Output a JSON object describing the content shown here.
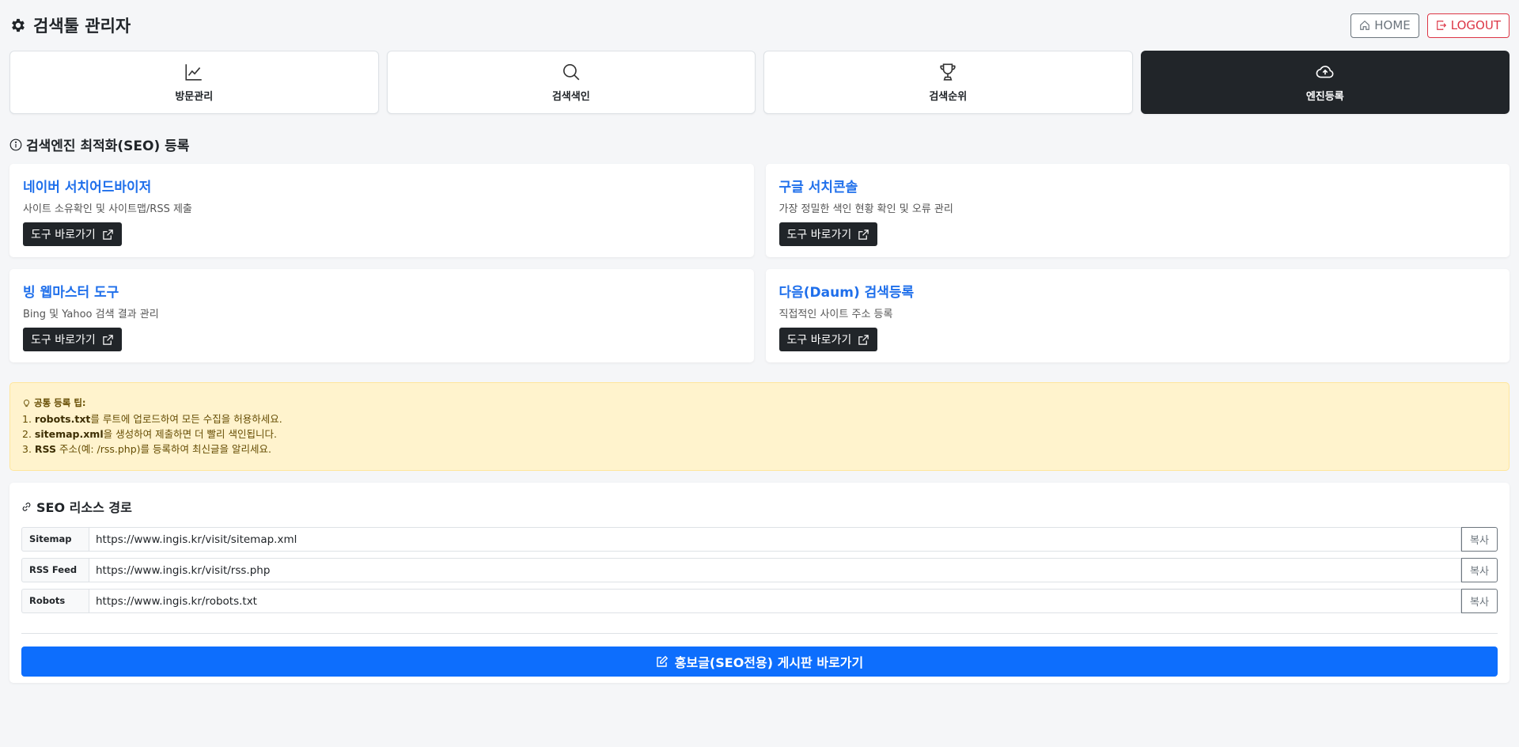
{
  "header": {
    "title": "검색툴 관리자",
    "home_label": "HOME",
    "logout_label": "LOGOUT"
  },
  "tabs": [
    {
      "label": "방문관리",
      "icon": "line-chart-icon"
    },
    {
      "label": "검색색인",
      "icon": "search-icon"
    },
    {
      "label": "검색순위",
      "icon": "trophy-icon"
    },
    {
      "label": "엔진등록",
      "icon": "cloud-upload-icon",
      "active": true
    }
  ],
  "section": {
    "title": "검색엔진 최적화(SEO) 등록"
  },
  "tools": [
    {
      "title": "네이버 서치어드바이저",
      "desc": "사이트 소유확인 및 사이트맵/RSS 제출",
      "button": "도구 바로가기"
    },
    {
      "title": "구글 서치콘솔",
      "desc": "가장 정밀한 색인 현황 확인 및 오류 관리",
      "button": "도구 바로가기"
    },
    {
      "title": "빙 웹마스터 도구",
      "desc": "Bing 및 Yahoo 검색 결과 관리",
      "button": "도구 바로가기"
    },
    {
      "title": "다음(Daum) 검색등록",
      "desc": "직접적인 사이트 주소 등록",
      "button": "도구 바로가기"
    }
  ],
  "tips": {
    "heading": "공통 등록 팁:",
    "items": [
      {
        "prefix": "1. ",
        "bold": "robots.txt",
        "rest": "를 루트에 업로드하여 모든 수집을 허용하세요."
      },
      {
        "prefix": "2. ",
        "bold": "sitemap.xml",
        "rest": "을 생성하여 제출하면 더 빨리 색인됩니다."
      },
      {
        "prefix": "3. ",
        "bold": "RSS",
        "rest": " 주소(예: /rss.php)를 등록하여 최신글을 알리세요."
      }
    ]
  },
  "resources": {
    "title": "SEO 리소스 경로",
    "copy_label": "복사",
    "rows": [
      {
        "label": "Sitemap",
        "value": "https://www.ingis.kr/visit/sitemap.xml"
      },
      {
        "label": "RSS Feed",
        "value": "https://www.ingis.kr/visit/rss.php"
      },
      {
        "label": "Robots",
        "value": "https://www.ingis.kr/robots.txt"
      }
    ],
    "board_button": "홍보글(SEO전용) 게시판 바로가기"
  },
  "colors": {
    "accent_blue": "#0d6efd",
    "link_blue": "#1f6feb",
    "dark": "#212529",
    "danger": "#dc3545",
    "warning_bg": "#fff3cd"
  }
}
